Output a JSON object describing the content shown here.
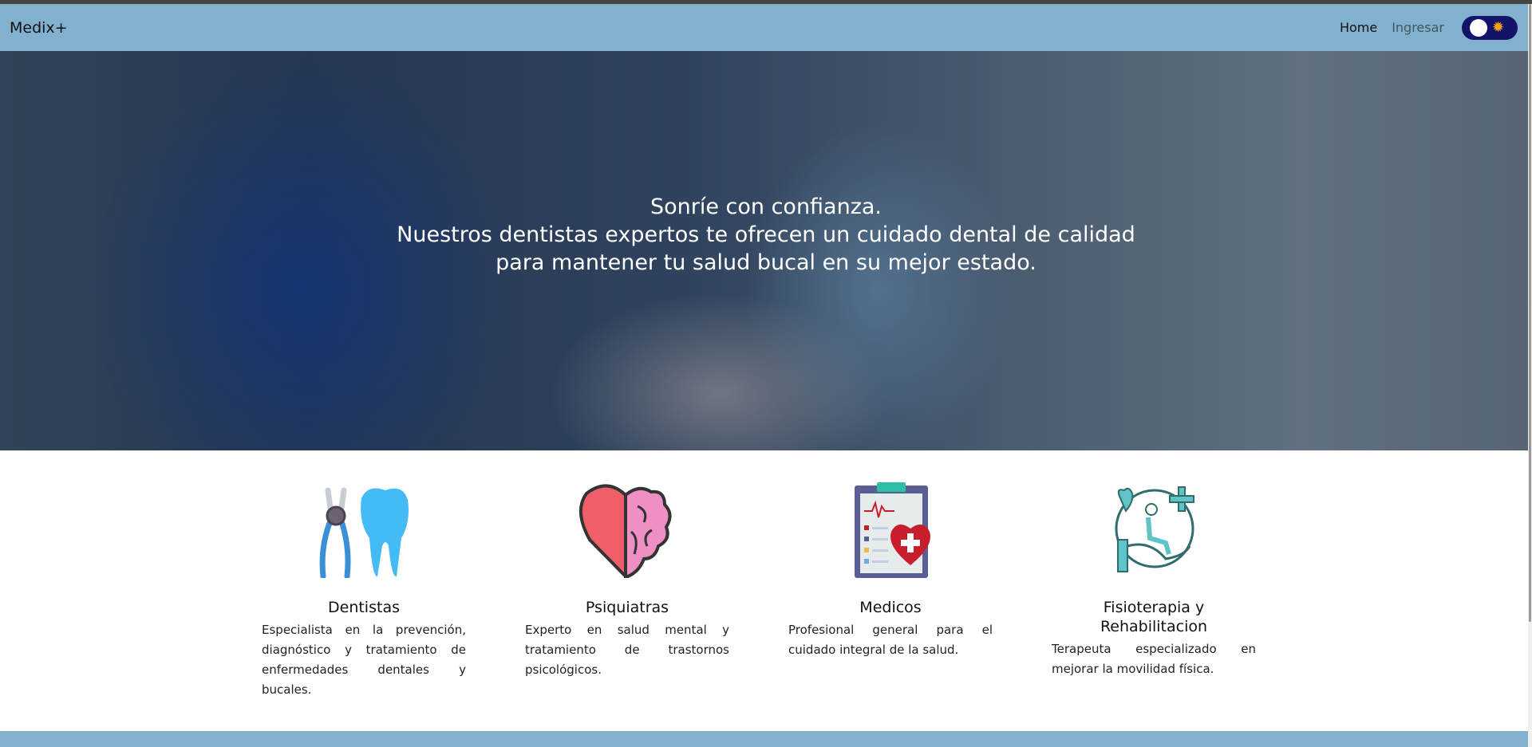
{
  "nav": {
    "brand": "Medix+",
    "links": [
      "Home",
      "Ingresar"
    ],
    "theme_toggle": "light"
  },
  "hero": {
    "lines": [
      "Sonríe con confianza.",
      "Nuestros dentistas expertos te ofrecen un cuidado dental de calidad",
      "para mantener tu salud bucal en su mejor estado."
    ]
  },
  "services": [
    {
      "title": "Dentistas",
      "icon": "tooth-pliers-icon",
      "desc": "Especialista en la prevención, diagnóstico y tratamiento de enfermedades dentales y bucales."
    },
    {
      "title": "Psiquiatras",
      "icon": "heart-brain-icon",
      "desc": "Experto en salud mental y tratamiento de trastornos psicológicos."
    },
    {
      "title": "Medicos",
      "icon": "clipboard-heart-icon",
      "desc": "Profesional general para el cuidado integral de la salud."
    },
    {
      "title": "Fisioterapia y Rehabilitacion",
      "icon": "rehab-hand-icon",
      "desc": "Terapeuta especializado en mejorar la movilidad física."
    }
  ]
}
